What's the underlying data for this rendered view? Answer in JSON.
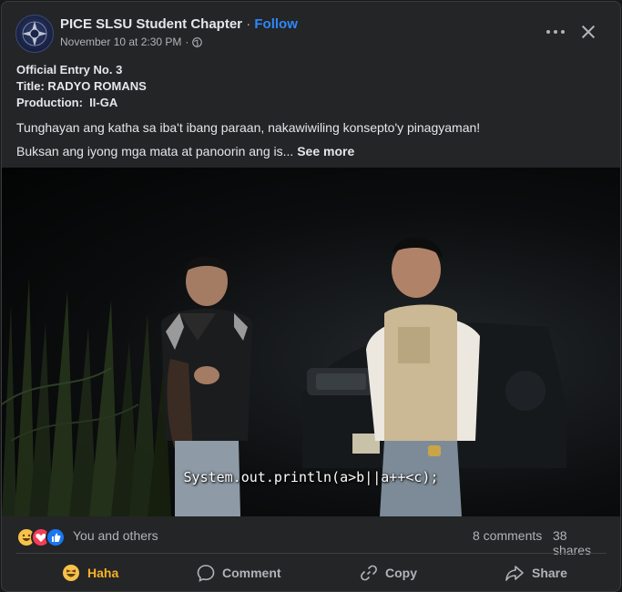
{
  "post": {
    "page_name": "PICE SLSU Student Chapter",
    "separator": " · ",
    "follow_label": "Follow",
    "timestamp": "November 10 at 2:30 PM",
    "meta_separator": "·",
    "privacy_icon": "globe-icon",
    "lines": {
      "entry": "Official Entry No. 3",
      "title": "Title: RADYO ROMANS",
      "production": "Production:  II-GA"
    },
    "paragraph1": "Tunghayan ang katha sa iba't ibang paraan, nakawiwiling konsepto'y pinagyaman!",
    "paragraph2": "Buksan ang iyong mga mata at panoorin ang is...",
    "see_more": "See more"
  },
  "video": {
    "subtitle": "System.out.println(a>b||a++<c);"
  },
  "reactions": {
    "icons": [
      "haha-reaction-icon",
      "love-reaction-icon",
      "like-reaction-icon"
    ],
    "summary": "You and others",
    "comments": "8 comments",
    "shares": "38 shares"
  },
  "actions": {
    "haha": "Haha",
    "comment": "Comment",
    "copy": "Copy",
    "share": "Share"
  },
  "colors": {
    "background": "#18191a",
    "card": "#242526",
    "accent_link": "#2d88ff",
    "haha_active": "#f7b125",
    "love": "#f33e58",
    "like": "#1877f2"
  }
}
